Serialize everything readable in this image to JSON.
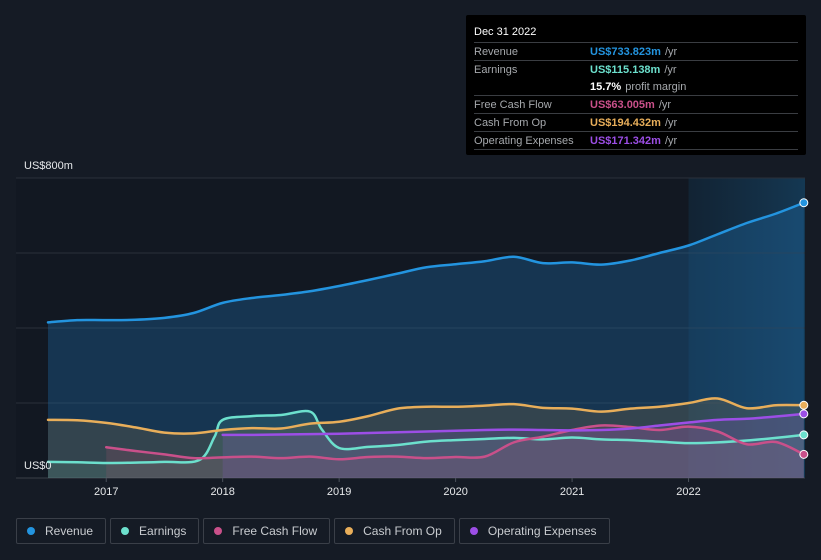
{
  "tooltip": {
    "date": "Dec 31 2022",
    "rows": [
      {
        "label": "Revenue",
        "value": "US$733.823m",
        "unit": "/yr",
        "color": "#2394df"
      },
      {
        "label": "Earnings",
        "value": "US$115.138m",
        "unit": "/yr",
        "color": "#6ce0cd"
      },
      {
        "label": "",
        "value": "15.7%",
        "unit": "profit margin",
        "color": "#ffffff"
      },
      {
        "label": "Free Cash Flow",
        "value": "US$63.005m",
        "unit": "/yr",
        "color": "#c9508a"
      },
      {
        "label": "Cash From Op",
        "value": "US$194.432m",
        "unit": "/yr",
        "color": "#e8ae5a"
      },
      {
        "label": "Operating Expenses",
        "value": "US$171.342m",
        "unit": "/yr",
        "color": "#9c4ee6"
      }
    ]
  },
  "legend": [
    {
      "label": "Revenue",
      "color": "#2394df"
    },
    {
      "label": "Earnings",
      "color": "#6ce0cd"
    },
    {
      "label": "Free Cash Flow",
      "color": "#c9508a"
    },
    {
      "label": "Cash From Op",
      "color": "#e8ae5a"
    },
    {
      "label": "Operating Expenses",
      "color": "#9c4ee6"
    }
  ],
  "chart_data": {
    "type": "area",
    "title": "",
    "xlabel": "",
    "ylabel": "",
    "y_axis_labels": [
      "US$800m",
      "US$0"
    ],
    "ylim": [
      0,
      800
    ],
    "xlim": [
      2016.5,
      2023.0
    ],
    "x_ticks": [
      2017,
      2018,
      2019,
      2020,
      2021,
      2022
    ],
    "grid": true,
    "legend_position": "bottom",
    "highlight_from": 2022.0,
    "series": [
      {
        "name": "Revenue",
        "color": "#2394df",
        "points": [
          [
            2016.5,
            415
          ],
          [
            2016.75,
            421
          ],
          [
            2017.0,
            421
          ],
          [
            2017.25,
            422
          ],
          [
            2017.5,
            427
          ],
          [
            2017.75,
            440
          ],
          [
            2018.0,
            467
          ],
          [
            2018.25,
            480
          ],
          [
            2018.5,
            488
          ],
          [
            2018.75,
            498
          ],
          [
            2019.0,
            512
          ],
          [
            2019.25,
            528
          ],
          [
            2019.5,
            545
          ],
          [
            2019.75,
            562
          ],
          [
            2020.0,
            570
          ],
          [
            2020.25,
            578
          ],
          [
            2020.5,
            590
          ],
          [
            2020.75,
            573
          ],
          [
            2021.0,
            575
          ],
          [
            2021.25,
            569
          ],
          [
            2021.5,
            580
          ],
          [
            2021.75,
            600
          ],
          [
            2022.0,
            620
          ],
          [
            2022.25,
            650
          ],
          [
            2022.5,
            680
          ],
          [
            2022.75,
            705
          ],
          [
            2022.99,
            734
          ]
        ]
      },
      {
        "name": "Earnings",
        "color": "#6ce0cd",
        "points": [
          [
            2016.5,
            43
          ],
          [
            2016.75,
            42
          ],
          [
            2017.0,
            40
          ],
          [
            2017.25,
            41
          ],
          [
            2017.5,
            43
          ],
          [
            2017.8,
            48
          ],
          [
            2017.93,
            110
          ],
          [
            2018.0,
            155
          ],
          [
            2018.25,
            165
          ],
          [
            2018.5,
            168
          ],
          [
            2018.75,
            177
          ],
          [
            2018.85,
            130
          ],
          [
            2019.0,
            80
          ],
          [
            2019.25,
            83
          ],
          [
            2019.5,
            88
          ],
          [
            2019.75,
            97
          ],
          [
            2020.0,
            101
          ],
          [
            2020.25,
            104
          ],
          [
            2020.5,
            107
          ],
          [
            2020.75,
            103
          ],
          [
            2021.0,
            108
          ],
          [
            2021.25,
            103
          ],
          [
            2021.5,
            101
          ],
          [
            2021.75,
            97
          ],
          [
            2022.0,
            93
          ],
          [
            2022.25,
            95
          ],
          [
            2022.5,
            100
          ],
          [
            2022.75,
            107
          ],
          [
            2022.99,
            115
          ]
        ]
      },
      {
        "name": "Free Cash Flow",
        "color": "#c9508a",
        "points": [
          [
            2017.0,
            82
          ],
          [
            2017.25,
            72
          ],
          [
            2017.5,
            63
          ],
          [
            2017.75,
            53
          ],
          [
            2018.0,
            55
          ],
          [
            2018.25,
            57
          ],
          [
            2018.5,
            53
          ],
          [
            2018.75,
            57
          ],
          [
            2019.0,
            50
          ],
          [
            2019.25,
            56
          ],
          [
            2019.5,
            57
          ],
          [
            2019.75,
            53
          ],
          [
            2020.0,
            56
          ],
          [
            2020.25,
            57
          ],
          [
            2020.5,
            95
          ],
          [
            2020.75,
            110
          ],
          [
            2021.0,
            128
          ],
          [
            2021.25,
            140
          ],
          [
            2021.5,
            136
          ],
          [
            2021.75,
            128
          ],
          [
            2022.0,
            137
          ],
          [
            2022.25,
            124
          ],
          [
            2022.5,
            90
          ],
          [
            2022.75,
            96
          ],
          [
            2022.99,
            63
          ]
        ]
      },
      {
        "name": "Cash From Op",
        "color": "#e8ae5a",
        "points": [
          [
            2016.5,
            155
          ],
          [
            2016.75,
            154
          ],
          [
            2017.0,
            147
          ],
          [
            2017.25,
            135
          ],
          [
            2017.5,
            121
          ],
          [
            2017.75,
            119
          ],
          [
            2018.0,
            128
          ],
          [
            2018.25,
            133
          ],
          [
            2018.5,
            132
          ],
          [
            2018.75,
            145
          ],
          [
            2019.0,
            150
          ],
          [
            2019.25,
            165
          ],
          [
            2019.5,
            185
          ],
          [
            2019.75,
            190
          ],
          [
            2020.0,
            190
          ],
          [
            2020.25,
            193
          ],
          [
            2020.5,
            197
          ],
          [
            2020.75,
            187
          ],
          [
            2021.0,
            185
          ],
          [
            2021.25,
            177
          ],
          [
            2021.5,
            185
          ],
          [
            2021.75,
            190
          ],
          [
            2022.0,
            200
          ],
          [
            2022.25,
            212
          ],
          [
            2022.5,
            186
          ],
          [
            2022.75,
            194
          ],
          [
            2022.99,
            194
          ]
        ]
      },
      {
        "name": "Operating Expenses",
        "color": "#9c4ee6",
        "points": [
          [
            2018.0,
            115
          ],
          [
            2018.25,
            115
          ],
          [
            2018.5,
            116
          ],
          [
            2018.75,
            117
          ],
          [
            2019.0,
            118
          ],
          [
            2019.25,
            120
          ],
          [
            2019.5,
            122
          ],
          [
            2019.75,
            124
          ],
          [
            2020.0,
            126
          ],
          [
            2020.25,
            128
          ],
          [
            2020.5,
            129
          ],
          [
            2020.75,
            128
          ],
          [
            2021.0,
            127
          ],
          [
            2021.25,
            128
          ],
          [
            2021.5,
            132
          ],
          [
            2021.75,
            140
          ],
          [
            2022.0,
            148
          ],
          [
            2022.25,
            155
          ],
          [
            2022.5,
            158
          ],
          [
            2022.75,
            164
          ],
          [
            2022.99,
            171
          ]
        ]
      }
    ]
  }
}
